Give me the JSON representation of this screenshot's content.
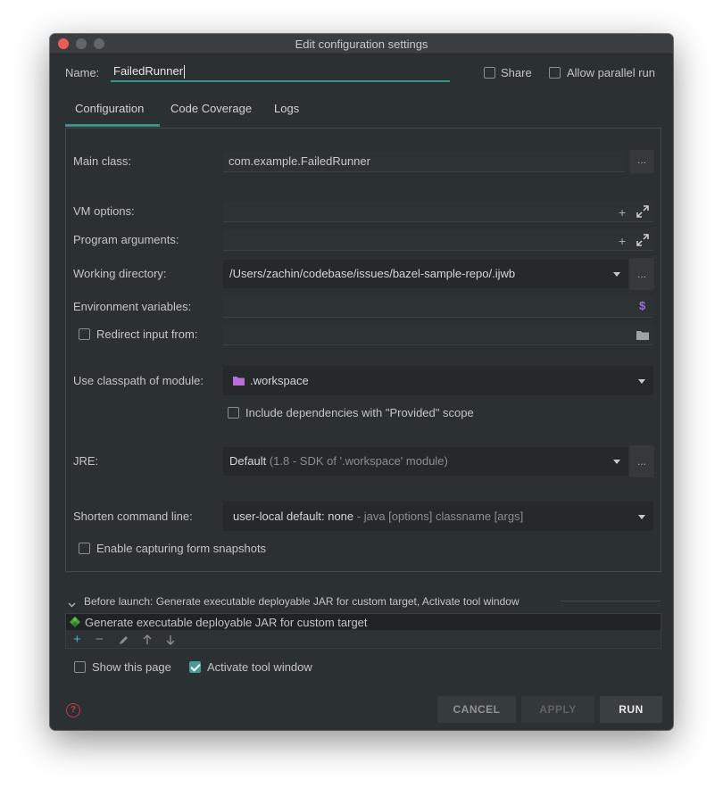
{
  "window": {
    "title": "Edit configuration settings"
  },
  "header": {
    "name_label": "Name:",
    "name_value": "FailedRunner",
    "share_label": "Share",
    "share_checked": false,
    "parallel_label": "Allow parallel run",
    "parallel_checked": false
  },
  "tabs": [
    {
      "label": "Configuration",
      "selected": true
    },
    {
      "label": "Code Coverage",
      "selected": false
    },
    {
      "label": "Logs",
      "selected": false
    }
  ],
  "form": {
    "main_class": {
      "label": "Main class:",
      "value": "com.example.FailedRunner",
      "button": "..."
    },
    "vm_options": {
      "label": "VM options:",
      "value": ""
    },
    "program_arguments": {
      "label": "Program arguments:",
      "value": ""
    },
    "working_directory": {
      "label": "Working directory:",
      "value": "/Users/zachin/codebase/issues/bazel-sample-repo/.ijwb",
      "button": "..."
    },
    "environment_variables": {
      "label": "Environment variables:",
      "value": "",
      "icon": "$"
    },
    "redirect_input": {
      "label": "Redirect input from:",
      "checked": false,
      "value": ""
    },
    "classpath_module": {
      "label": "Use classpath of module:",
      "value": ".workspace"
    },
    "include_provided": {
      "label": "Include dependencies with \"Provided\" scope",
      "checked": false
    },
    "jre": {
      "label": "JRE:",
      "value": "Default",
      "detail": "(1.8 - SDK of '.workspace' module)",
      "button": "..."
    },
    "shorten_command_line": {
      "label": "Shorten command line:",
      "value": "user-local default: none",
      "detail": "- java [options] classname [args]"
    },
    "capture_snapshots": {
      "label": "Enable capturing form snapshots",
      "checked": false
    }
  },
  "before_launch": {
    "header": "Before launch: Generate executable deployable JAR for custom target, Activate tool window",
    "items": [
      "Generate executable deployable JAR for custom target"
    ],
    "toolbar": {
      "add": "+",
      "remove": "−"
    }
  },
  "footer": {
    "show_page_label": "Show this page",
    "show_page_checked": false,
    "activate_tool_label": "Activate tool window",
    "activate_tool_checked": true,
    "help": "?",
    "cancel": "CANCEL",
    "apply": "APPLY",
    "run": "RUN"
  },
  "colors": {
    "background": "#2b3033",
    "accent": "#3d8f8a",
    "close": "#ee5a55",
    "module_icon": "#b56fd6",
    "env_icon": "#9b6fe0"
  }
}
